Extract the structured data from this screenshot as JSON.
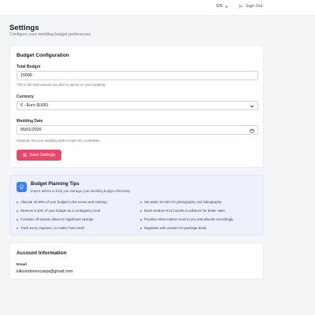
{
  "header": {
    "language": "EN",
    "sign_out": "Sign Out"
  },
  "page": {
    "title": "Settings",
    "subtitle": "Configure your wedding budget preferences"
  },
  "budget_config": {
    "title": "Budget Configuration",
    "total_budget_label": "Total Budget",
    "total_budget_value": "15000",
    "total_budget_help": "This is the total amount you plan to spend on your wedding",
    "currency_label": "Currency",
    "currency_value": "€ - Euro (EUR)",
    "wedding_date_label": "Wedding Date",
    "wedding_date_value": "05/01/2026",
    "wedding_date_help": "Optional: Set your wedding date to track the countdown",
    "save_label": "Save Settings"
  },
  "tips": {
    "title": "Budget Planning Tips",
    "subtitle": "Expert advice to help you manage your wedding budget effectively",
    "left": [
      "Allocate 40-50% of your budget to the venue and catering",
      "Reserve 5-10% of your budget as a contingency fund",
      "Consider off-season dates for significant savings",
      "Track every expense, no matter how small"
    ],
    "right": [
      "Set aside 10-15% for photography and videography",
      "Book vendors 9-12 months in advance for better rates",
      "Prioritize what matters most to you and allocate accordingly",
      "Negotiate with vendors for package deals"
    ]
  },
  "account": {
    "title": "Account Information",
    "email_label": "Email",
    "email_value": "klikomdovencanja@gmail.com"
  },
  "colors": {
    "accent": "#e8496a",
    "tip_accent": "#3b82f6",
    "tips_bg": "#eef1fc"
  }
}
